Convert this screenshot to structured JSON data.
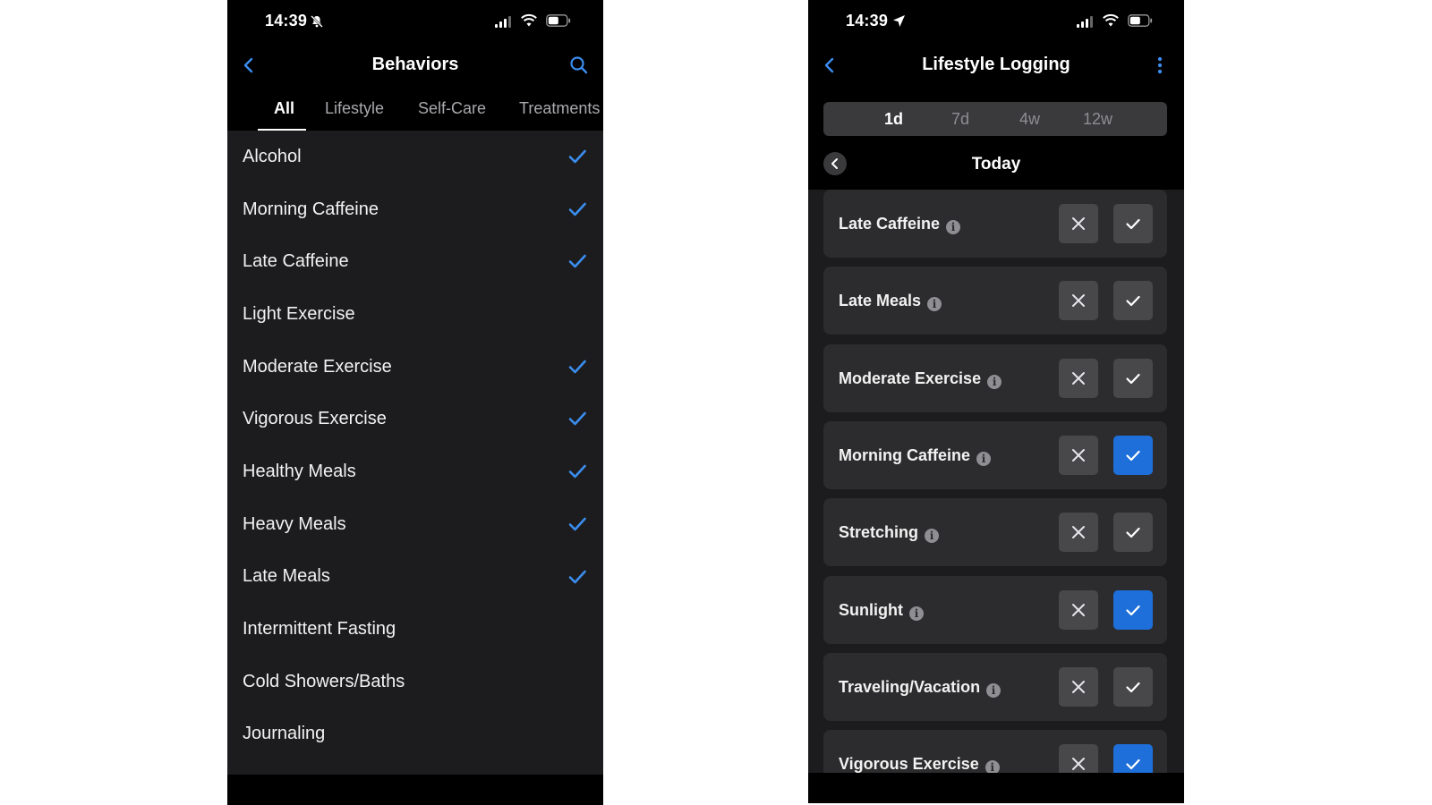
{
  "left": {
    "status": {
      "time": "14:39",
      "time_icon": "bell-slash-icon"
    },
    "title": "Behaviors",
    "back_icon": "chevron-left-icon",
    "search_icon": "search-icon",
    "tabs": [
      {
        "label": "All",
        "active": true
      },
      {
        "label": "Lifestyle",
        "active": false
      },
      {
        "label": "Self-Care",
        "active": false
      },
      {
        "label": "Treatments",
        "active": false
      }
    ],
    "items": [
      {
        "label": "Alcohol",
        "checked": true
      },
      {
        "label": "Morning Caffeine",
        "checked": true
      },
      {
        "label": "Late Caffeine",
        "checked": true
      },
      {
        "label": "Light Exercise",
        "checked": false
      },
      {
        "label": "Moderate Exercise",
        "checked": true
      },
      {
        "label": "Vigorous Exercise",
        "checked": true
      },
      {
        "label": "Healthy Meals",
        "checked": true
      },
      {
        "label": "Heavy Meals",
        "checked": true
      },
      {
        "label": "Late Meals",
        "checked": true
      },
      {
        "label": "Intermittent Fasting",
        "checked": false
      },
      {
        "label": "Cold Showers/Baths",
        "checked": false
      },
      {
        "label": "Journaling",
        "checked": false
      }
    ]
  },
  "right": {
    "status": {
      "time": "14:39",
      "time_icon": "location-arrow-icon"
    },
    "title": "Lifestyle Logging",
    "back_icon": "chevron-left-icon",
    "menu_icon": "more-vertical-icon",
    "ranges": [
      {
        "label": "1d",
        "active": true
      },
      {
        "label": "7d",
        "active": false
      },
      {
        "label": "4w",
        "active": false
      },
      {
        "label": "12w",
        "active": false
      }
    ],
    "date_label": "Today",
    "cards": [
      {
        "label": "Late Caffeine",
        "yes": false
      },
      {
        "label": "Late Meals",
        "yes": false
      },
      {
        "label": "Moderate Exercise",
        "yes": false
      },
      {
        "label": "Morning Caffeine",
        "yes": true
      },
      {
        "label": "Stretching",
        "yes": false
      },
      {
        "label": "Sunlight",
        "yes": true
      },
      {
        "label": "Traveling/Vacation",
        "yes": false
      },
      {
        "label": "Vigorous Exercise",
        "yes": true
      }
    ]
  },
  "colors": {
    "accent": "#1e6fd9",
    "link_blue": "#3b8ef0",
    "list_bg": "#1c1c1e",
    "card_bg": "#2c2c2e"
  }
}
